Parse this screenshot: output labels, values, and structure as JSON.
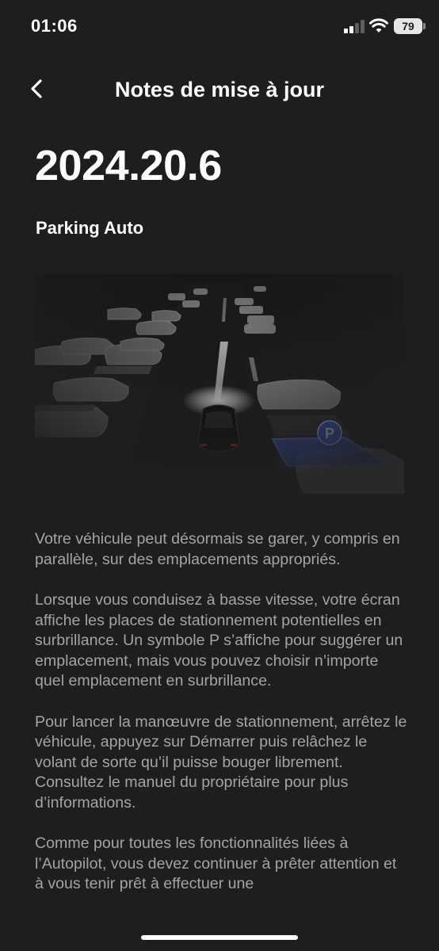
{
  "status_bar": {
    "time": "01:06",
    "battery": "79"
  },
  "header": {
    "title": "Notes de mise à jour",
    "back_icon": "chevron-left-icon"
  },
  "release": {
    "version": "2024.20.6",
    "feature_title": "Parking Auto",
    "illustration_badge": "P",
    "paragraphs": [
      "Votre véhicule peut désormais se garer, y compris en parallèle, sur des emplacements appropriés.",
      "Lorsque vous conduisez à basse vitesse, votre écran affiche les places de stationnement potentielles en surbrillance. Un symbole P s’affiche pour suggérer un emplacement, mais vous pouvez choisir n’importe quel emplacement en surbrillance.",
      "Pour lancer la manœuvre de stationnement, arrêtez le véhicule, appuyez sur Démarrer puis relâchez le volant de sorte qu’il puisse bouger librement. Consultez le manuel du propriétaire pour plus d’informations.",
      "Comme pour toutes les fonctionnalités liées à l’Autopilot, vous devez continuer à prêter attention et à vous tenir prêt à effectuer une"
    ]
  },
  "colors": {
    "background": "#1e1e1f",
    "body_text": "#a4a4a6",
    "highlight_blue": "#3a5fe0"
  }
}
